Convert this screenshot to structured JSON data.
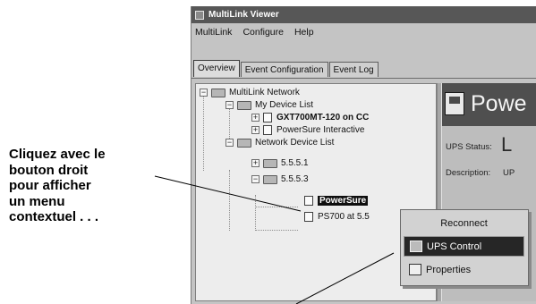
{
  "window": {
    "title": "MultiLink Viewer"
  },
  "menubar": {
    "items": [
      "MultiLink",
      "Configure",
      "Help"
    ]
  },
  "tabs": [
    "Overview",
    "Event Configuration",
    "Event Log"
  ],
  "tree": {
    "root": "MultiLink Network",
    "my_device_list": "My Device List",
    "device_1": "GXT700MT-120 on CC",
    "device_2": "PowerSure Interactive",
    "network_device_list": "Network Device List",
    "net_1": "5.5.5.1",
    "net_2": "5.5.5.3",
    "selected_device": "PowerSure",
    "device_3": "PS700 at 5.5"
  },
  "right_pane": {
    "header_title": "Powe",
    "ups_status_label": "UPS Status:",
    "ups_status_value": "L",
    "description_label": "Description:",
    "description_value": "UP"
  },
  "context_menu": {
    "reconnect": "Reconnect",
    "ups_control": "UPS Control",
    "properties": "Properties"
  },
  "callout": {
    "lines": [
      "Cliquez avec le",
      "bouton droit",
      "pour afficher",
      "un menu",
      "contextuel . . ."
    ]
  }
}
